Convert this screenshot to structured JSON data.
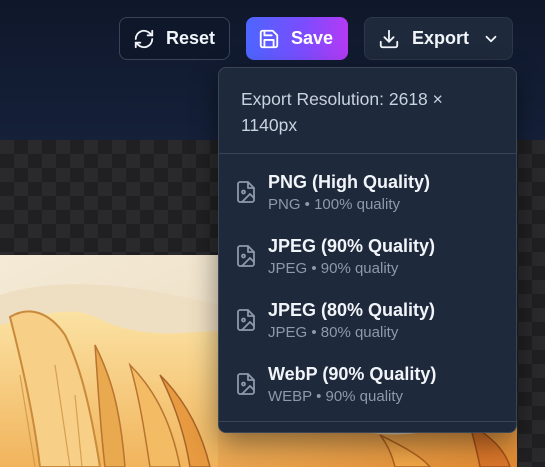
{
  "toolbar": {
    "reset_label": "Reset",
    "save_label": "Save",
    "export_label": "Export",
    "icons": {
      "reset": "rotate-ccw-icon",
      "save": "save-icon",
      "export": "download-icon",
      "chevron": "chevron-down-icon"
    }
  },
  "export_menu": {
    "resolution": "Export Resolution: 2618 × 1140px",
    "items": [
      {
        "label": "PNG (High Quality)",
        "detail": "PNG • 100% quality",
        "icon": "image-file-icon"
      },
      {
        "label": "JPEG (90% Quality)",
        "detail": "JPEG • 90% quality",
        "icon": "image-file-icon"
      },
      {
        "label": "JPEG (80% Quality)",
        "detail": "JPEG • 80% quality",
        "icon": "image-file-icon"
      },
      {
        "label": "WebP (90% Quality)",
        "detail": "WEBP • 90% quality",
        "icon": "image-file-icon"
      }
    ]
  },
  "colors": {
    "save_gradient_start": "#4d66ff",
    "save_gradient_end": "#b43af5",
    "menu_background": "#1e293b",
    "header_background": "#0f172a"
  }
}
